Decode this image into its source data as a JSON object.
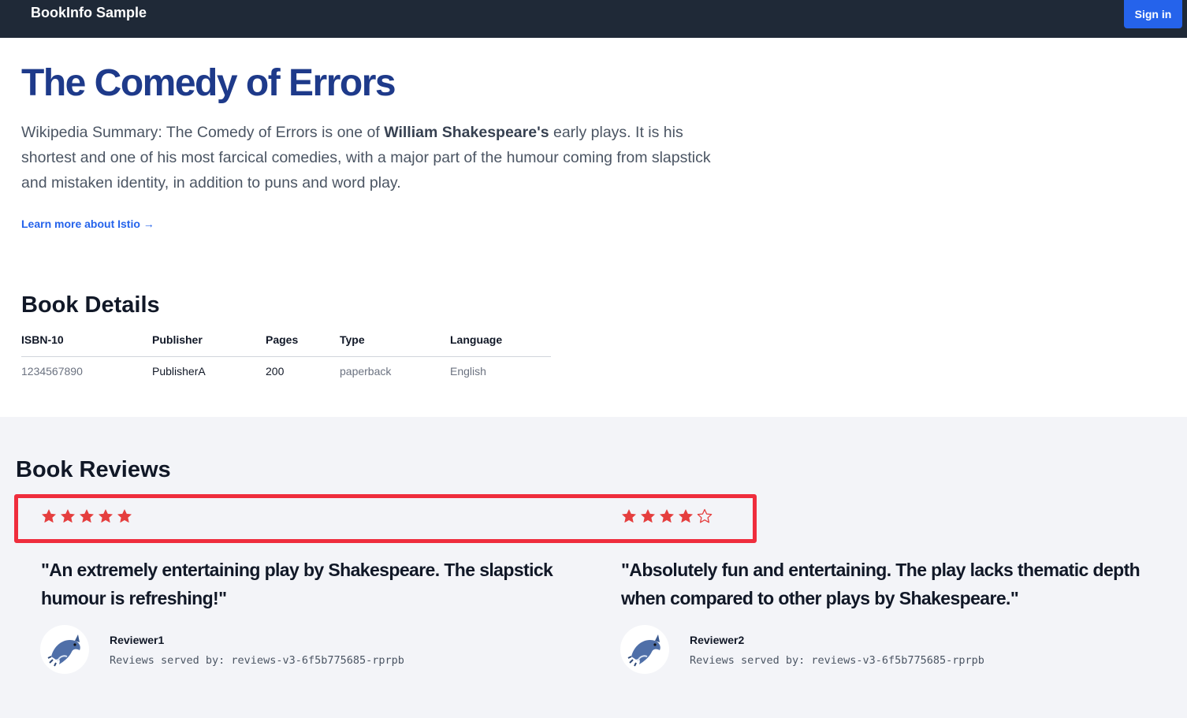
{
  "navbar": {
    "brand": "BookInfo Sample",
    "signin_label": "Sign in"
  },
  "book": {
    "title": "The Comedy of Errors",
    "summary_before": "Wikipedia Summary: The Comedy of Errors is one of ",
    "summary_bold": "William Shakespeare's",
    "summary_after": " early plays. It is his shortest and one of his most farcical comedies, with a major part of the humour coming from slapstick and mistaken identity, in addition to puns and word play.",
    "learn_more": "Learn more about Istio →"
  },
  "details": {
    "heading": "Book Details",
    "columns": [
      "ISBN-10",
      "Publisher",
      "Pages",
      "Type",
      "Language"
    ],
    "row": [
      "1234567890",
      "PublisherA",
      "200",
      "paperback",
      "English"
    ]
  },
  "reviews": {
    "heading": "Book Reviews",
    "star_color": "#e53e3e",
    "highlight_color": "#ef2d3d",
    "items": [
      {
        "rating": 5,
        "max_rating": 5,
        "text": "\"An extremely entertaining play by Shakespeare. The slapstick humour is refreshing!\"",
        "reviewer": "Reviewer1",
        "served_by": "Reviews served by: reviews-v3-6f5b775685-rprpb",
        "avatar": "dolphin-avatar"
      },
      {
        "rating": 4,
        "max_rating": 5,
        "text": "\"Absolutely fun and entertaining. The play lacks thematic depth when compared to other plays by Shakespeare.\"",
        "reviewer": "Reviewer2",
        "served_by": "Reviews served by: reviews-v3-6f5b775685-rprpb",
        "avatar": "dolphin-avatar"
      }
    ]
  }
}
